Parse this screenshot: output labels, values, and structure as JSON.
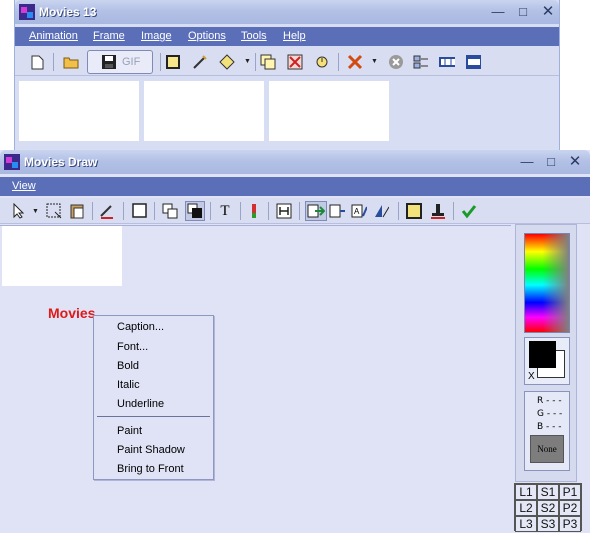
{
  "movies13_window": {
    "title": "Movies 13",
    "menu": [
      "Animation",
      "Frame",
      "Image",
      "Options",
      "Tools",
      "Help"
    ],
    "gif_button_label": "GIF",
    "window_controls": [
      "minimize",
      "maximize",
      "close"
    ]
  },
  "draw_window": {
    "title": "Movies Draw",
    "menu": [
      "View"
    ],
    "canvas_text": "Movies"
  },
  "context_menu": {
    "items": [
      "Caption...",
      "Font...",
      "Bold",
      "Italic",
      "Underline",
      "Paint",
      "Paint Shadow",
      "Bring to Front"
    ]
  },
  "palette": {
    "rgb": [
      "R - - -",
      "G - - -",
      "B - - -"
    ],
    "none_button": "None",
    "swatch_marker": "X",
    "foreground_color": "#000000",
    "background_color": "#ffffff"
  },
  "layer_buttons": [
    "L1",
    "S1",
    "P1",
    "L2",
    "S2",
    "P2",
    "L3",
    "S3",
    "P3"
  ],
  "colors": {
    "menubar": "#5b6fb8",
    "caption_text": "#e01818",
    "accept_check": "#1a9a2a"
  }
}
